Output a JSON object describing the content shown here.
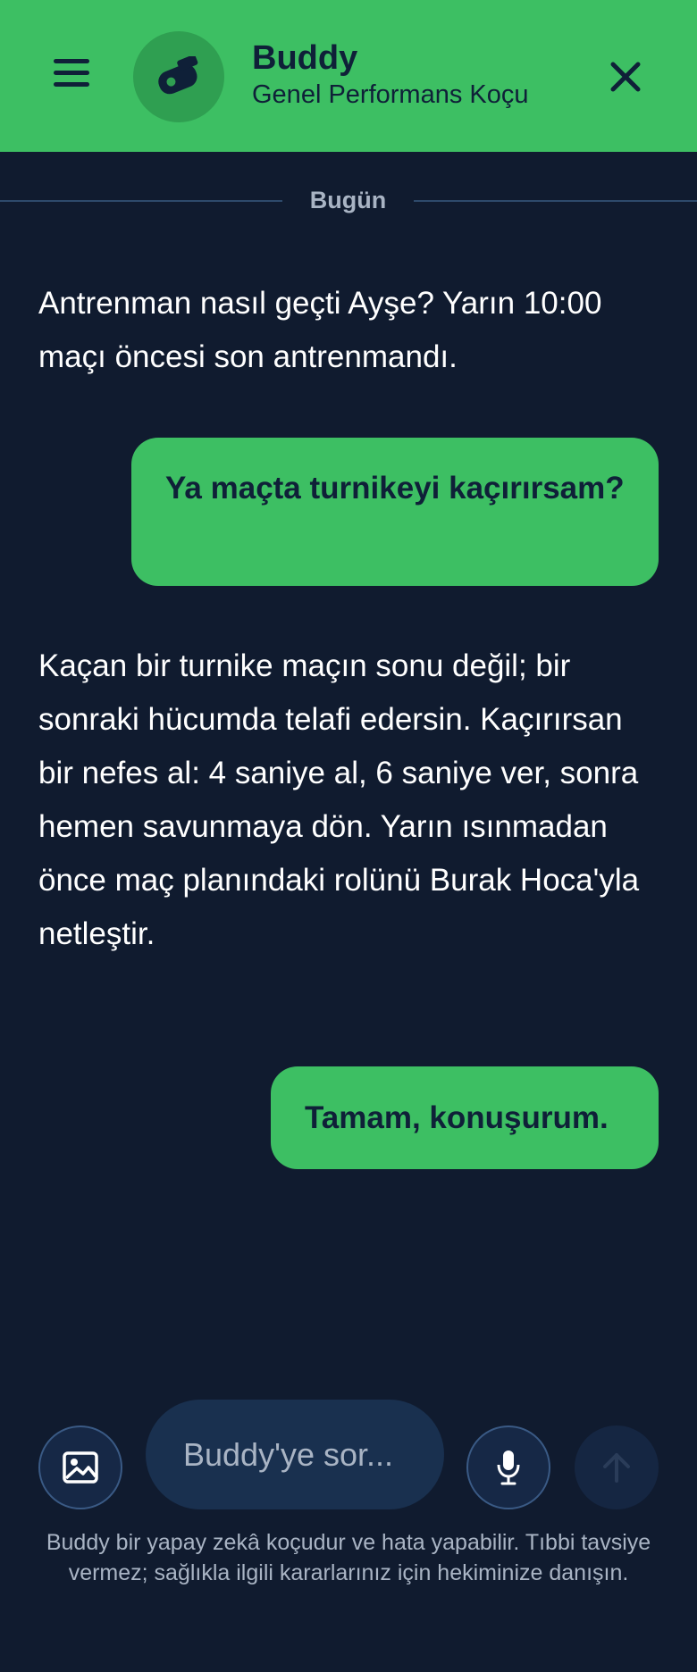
{
  "header": {
    "coach_name": "Buddy",
    "coach_role": "Genel Performans Koçu",
    "menu_icon": "hamburger-menu-icon",
    "avatar_icon": "whistle-icon",
    "close_icon": "close-icon",
    "accent_color": "#3dbf63"
  },
  "divider": {
    "label": "Bugün"
  },
  "messages": [
    {
      "sender": "bot",
      "text": "Antrenman nasıl geçti Ayşe? Yarın 10:00 maçı öncesi son antrenmandı."
    },
    {
      "sender": "user",
      "text": "Ya maçta turnikeyi kaçırırsam?"
    },
    {
      "sender": "bot",
      "text": "Kaçan bir turnike maçın sonu değil; bir sonraki hücumda telafi edersin. Kaçırırsan bir nefes al: 4 saniye al, 6 saniye ver, sonra hemen savunmaya dön. Yarın ısınmadan önce maç planındaki rolünü Burak Hoca'yla netleştir."
    },
    {
      "sender": "user",
      "text": "Tamam, konuşurum."
    }
  ],
  "composer": {
    "placeholder": "Buddy'ye sor...",
    "value": "",
    "image_icon": "image-icon",
    "mic_icon": "microphone-icon",
    "send_icon": "arrow-up-icon"
  },
  "disclaimer": "Buddy bir yapay zekâ koçudur ve hata yapabilir. Tıbbi tavsiye vermez; sağlıkla ilgili kararlarınız için hekiminize danışın.",
  "colors": {
    "background": "#101b2f",
    "user_bubble": "#3dbf63",
    "muted_text": "#a9b4c4"
  }
}
